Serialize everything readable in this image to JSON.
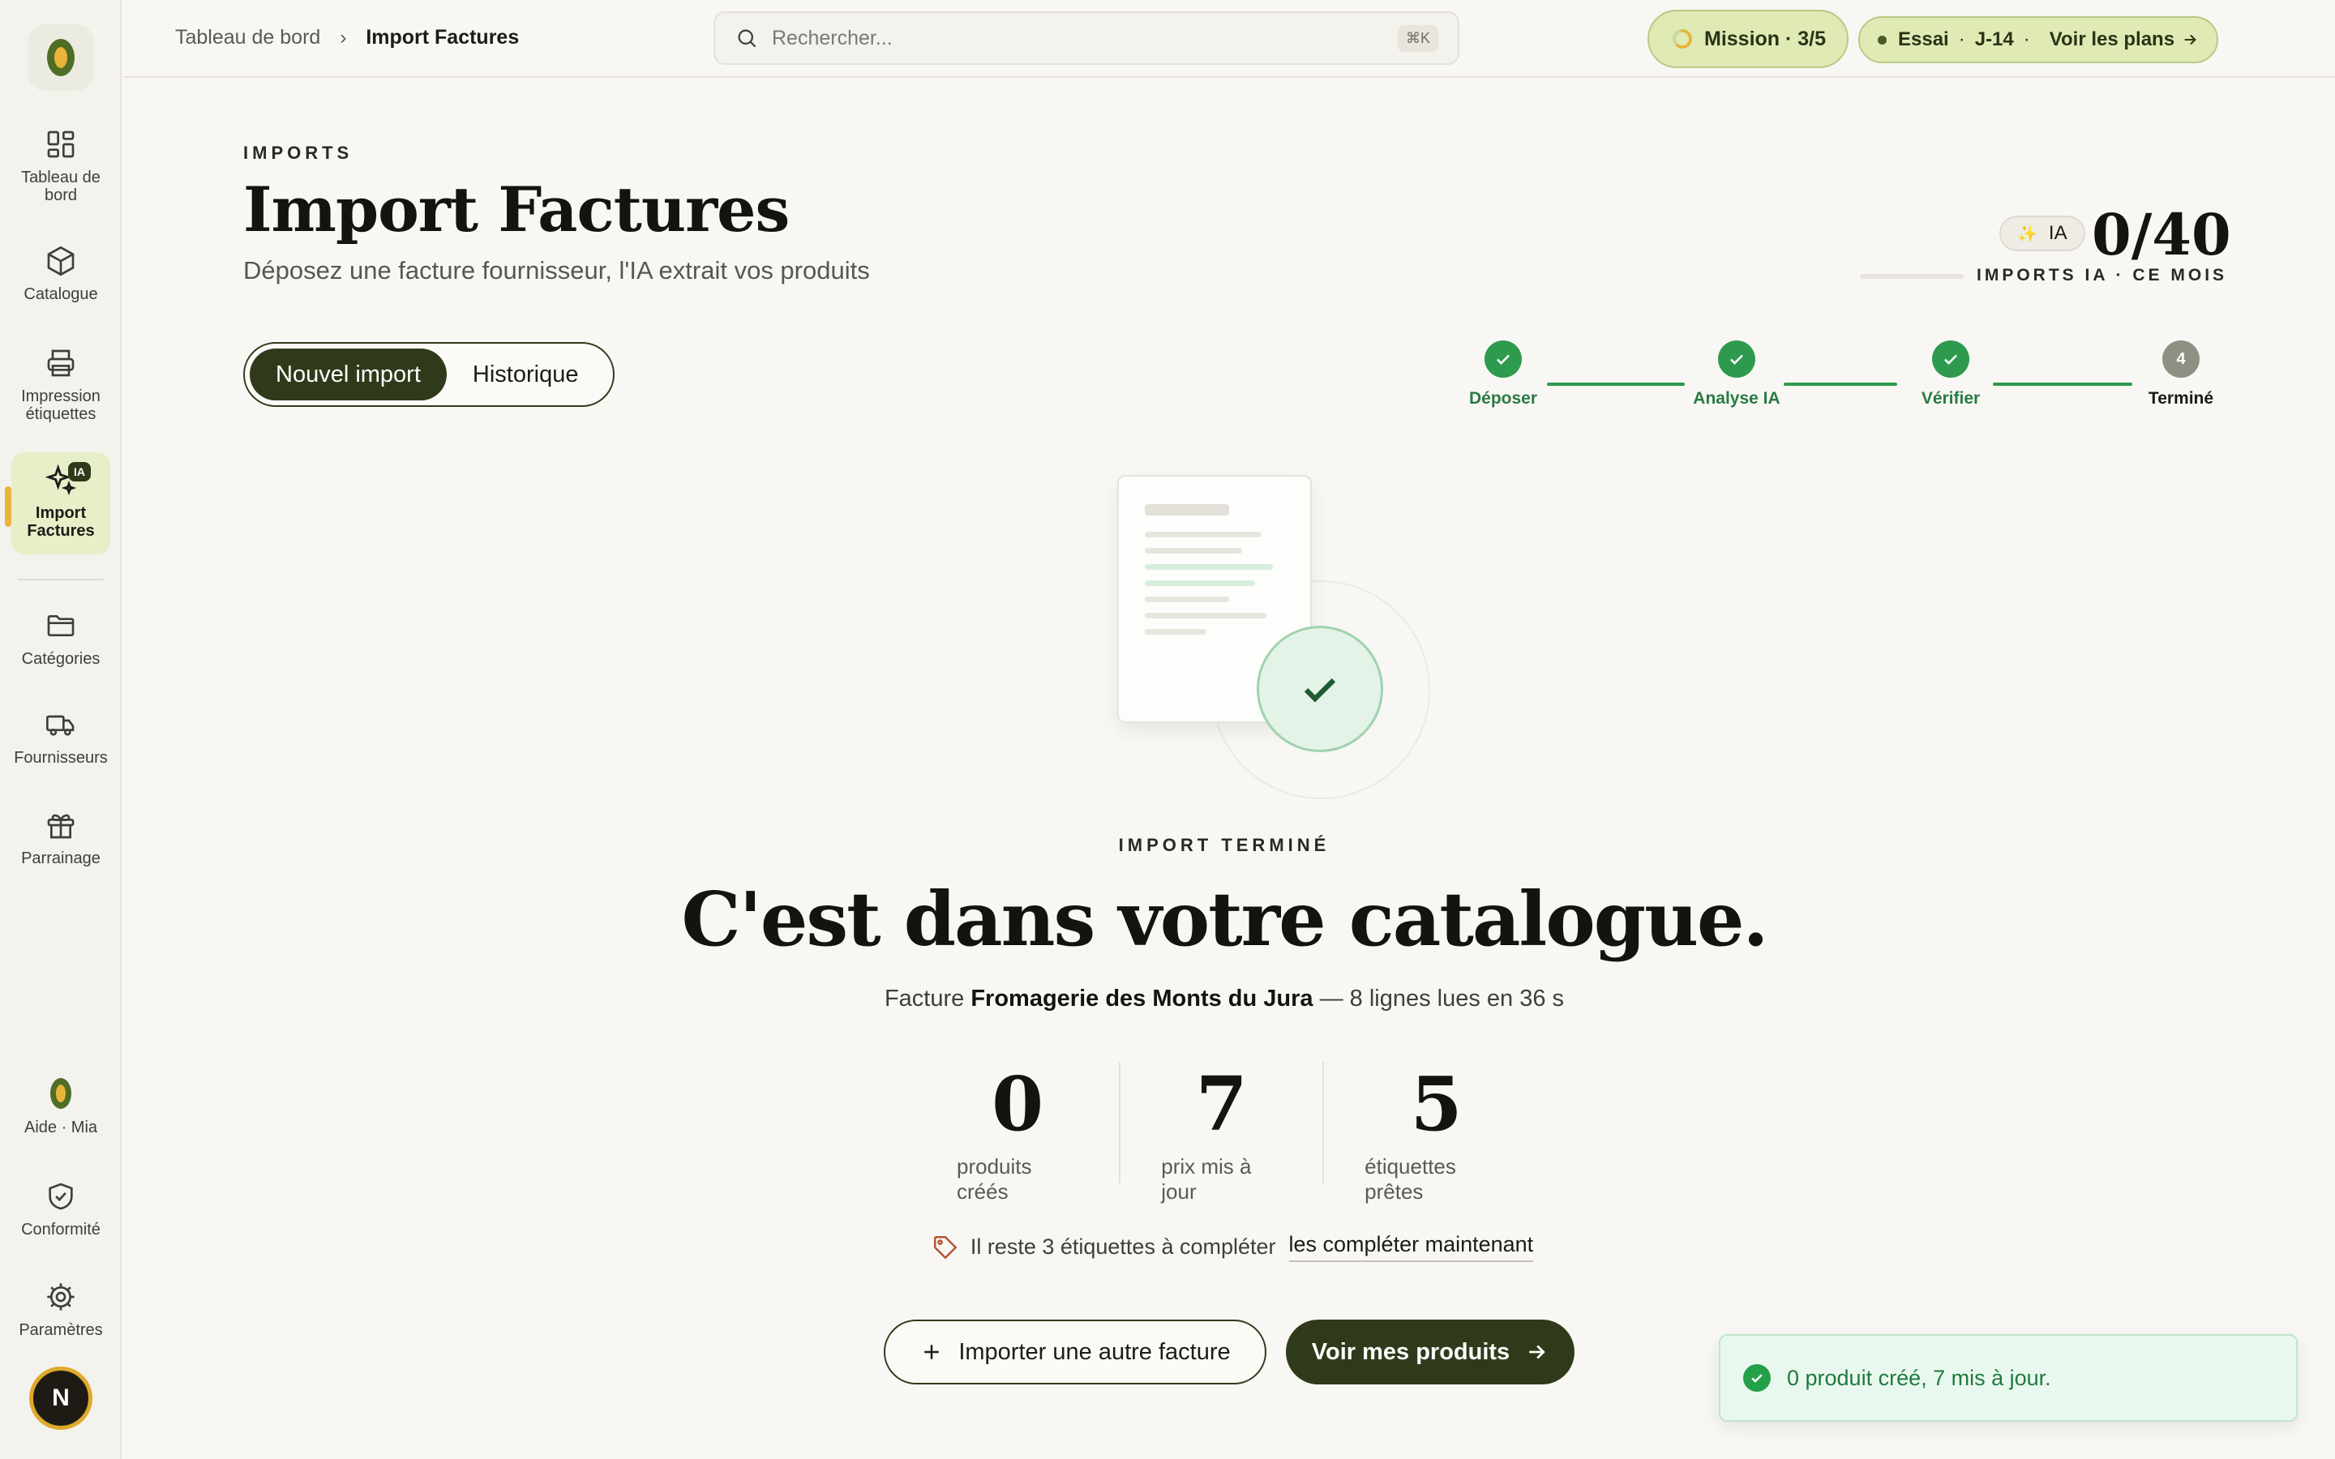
{
  "sidebar": {
    "items": [
      {
        "label": "Tableau de bord",
        "icon": "dashboard-icon"
      },
      {
        "label": "Catalogue",
        "icon": "box-icon"
      },
      {
        "label": "Impression étiquettes",
        "icon": "printer-icon"
      },
      {
        "label": "Import Factures",
        "icon": "sparkles-icon",
        "badge": "IA",
        "active": true
      },
      {
        "label": "Catégories",
        "icon": "folder-icon"
      },
      {
        "label": "Fournisseurs",
        "icon": "truck-icon"
      },
      {
        "label": "Parrainage",
        "icon": "gift-icon"
      }
    ],
    "bottom": [
      {
        "label": "Aide · Mia",
        "icon": "olive-icon"
      },
      {
        "label": "Conformité",
        "icon": "shield-check-icon"
      },
      {
        "label": "Paramètres",
        "icon": "gear-icon"
      }
    ],
    "avatar_initial": "N"
  },
  "topbar": {
    "breadcrumb": [
      "Tableau de bord",
      "Import Factures"
    ],
    "search_placeholder": "Rechercher...",
    "search_shortcut": "⌘K",
    "mission": "Mission · 3/5",
    "mission_progress": 0.6,
    "trial": {
      "label": "Essai",
      "days": "J-14",
      "cta": "Voir les plans"
    }
  },
  "header": {
    "eyebrow": "IMPORTS",
    "title": "Import Factures",
    "subtitle": "Déposez une facture fournisseur, l'IA extrait vos produits",
    "usage": {
      "badge": "IA",
      "count": "0/40",
      "label": "IMPORTS IA · CE MOIS",
      "fraction": 0.0
    }
  },
  "tabs": [
    {
      "label": "Nouvel import",
      "active": true
    },
    {
      "label": "Historique",
      "active": false
    }
  ],
  "stepper": [
    {
      "label": "Déposer",
      "done": true
    },
    {
      "label": "Analyse IA",
      "done": true
    },
    {
      "label": "Vérifier",
      "done": true
    },
    {
      "label": "Terminé",
      "number": "4",
      "done": false
    }
  ],
  "result": {
    "eyebrow": "IMPORT TERMINÉ",
    "title": "C'est dans votre catalogue.",
    "summary_prefix": "Facture",
    "supplier": "Fromagerie des Monts du Jura",
    "summary_suffix": "— 8 lignes lues en 36 s",
    "stats": [
      {
        "value": "0",
        "label": "produits créés"
      },
      {
        "value": "7",
        "label": "prix mis à jour"
      },
      {
        "value": "5",
        "label": "étiquettes prêtes"
      }
    ],
    "remaining_text": "Il reste 3 étiquettes à compléter",
    "remaining_link": "les compléter maintenant",
    "btn_import_other": "Importer une autre facture",
    "btn_view_products": "Voir mes produits"
  },
  "toast": {
    "message": "0 produit créé, 7 mis à jour."
  },
  "colors": {
    "brand_dark": "#2f3a1a",
    "accent_green": "#2e9a4e",
    "olive_yellow": "#e9b43a",
    "mission_bg": "#dfeab5"
  }
}
